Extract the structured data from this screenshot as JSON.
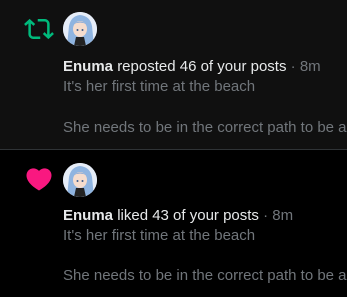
{
  "notifications": [
    {
      "icon": "repost-icon",
      "icon_color": "#00ba7c",
      "user": "Enuma",
      "action": "reposted 46 of your posts",
      "separator": "·",
      "time": "8m",
      "line1": "It's her first time at the beach",
      "line2": "She needs to be in the correct path to be a"
    },
    {
      "icon": "heart-icon",
      "icon_color": "#f91880",
      "user": "Enuma",
      "action": "liked 43 of your posts",
      "separator": "·",
      "time": "8m",
      "line1": "It's her first time at the beach",
      "line2": "She needs to be in the correct path to be a"
    }
  ]
}
